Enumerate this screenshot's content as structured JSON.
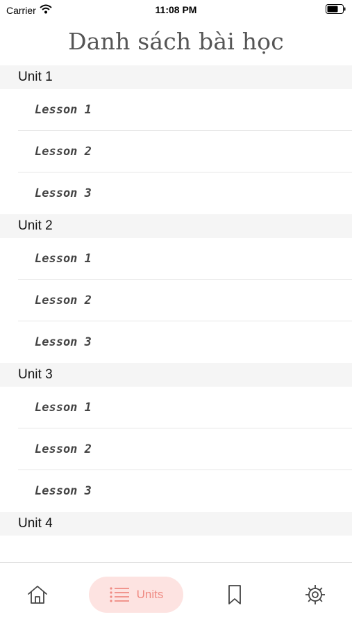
{
  "status_bar": {
    "carrier": "Carrier",
    "time": "11:08 PM"
  },
  "header": {
    "title": "Danh sách bài học"
  },
  "units": [
    {
      "label": "Unit 1",
      "lessons": [
        "Lesson 1",
        "Lesson 2",
        "Lesson 3"
      ]
    },
    {
      "label": "Unit 2",
      "lessons": [
        "Lesson 1",
        "Lesson 2",
        "Lesson 3"
      ]
    },
    {
      "label": "Unit 3",
      "lessons": [
        "Lesson 1",
        "Lesson 2",
        "Lesson 3"
      ]
    },
    {
      "label": "Unit 4",
      "lessons": []
    }
  ],
  "tab_bar": {
    "tabs": [
      {
        "name": "home",
        "icon": "home-icon",
        "label": ""
      },
      {
        "name": "units",
        "icon": "list-icon",
        "label": "Units",
        "selected": true
      },
      {
        "name": "bookmark",
        "icon": "bookmark-icon",
        "label": ""
      },
      {
        "name": "settings",
        "icon": "gear-icon",
        "label": ""
      }
    ]
  },
  "colors": {
    "accent": "#ef8a82",
    "accent_bg": "#fde3e1",
    "section_bg": "#f5f5f5",
    "title": "#555555"
  }
}
